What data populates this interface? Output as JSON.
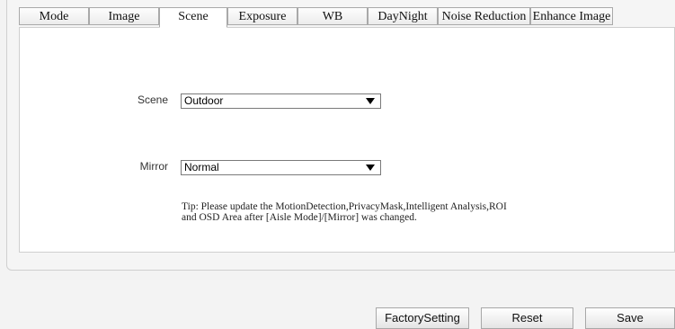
{
  "tabs": [
    {
      "label": "Mode"
    },
    {
      "label": "Image"
    },
    {
      "label": "Scene",
      "active": true
    },
    {
      "label": "Exposure"
    },
    {
      "label": "WB"
    },
    {
      "label": "DayNight"
    },
    {
      "label": "Noise Reduction"
    },
    {
      "label": "Enhance Image"
    }
  ],
  "form": {
    "scene": {
      "label": "Scene",
      "value": "Outdoor"
    },
    "mirror": {
      "label": "Mirror",
      "value": "Normal"
    }
  },
  "tip": "Tip: Please update the MotionDetection,PrivacyMask,Intelligent Analysis,ROI and OSD Area after [Aisle Mode]/[Mirror] was changed.",
  "buttons": {
    "factory": "FactorySetting",
    "reset": "Reset",
    "save": "Save"
  }
}
